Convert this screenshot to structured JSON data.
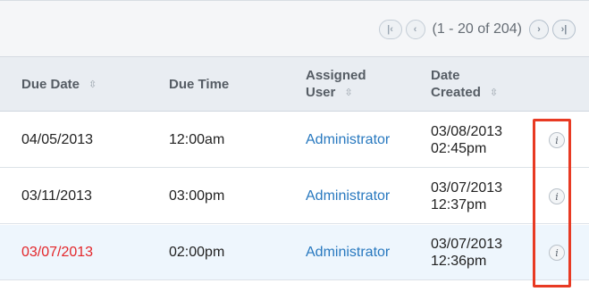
{
  "pager": {
    "first_icon": "first-page-icon",
    "prev_icon": "previous-page-icon",
    "next_icon": "next-page-icon",
    "last_icon": "last-page-icon",
    "first_glyph": "|‹",
    "prev_glyph": "‹",
    "next_glyph": "›",
    "last_glyph": "›|",
    "range_text": "(1 - 20 of 204)"
  },
  "columns": {
    "due_date": "Due Date",
    "due_time": "Due Time",
    "assigned_user_line1": "Assigned",
    "assigned_user_line2": "User",
    "date_created_line1": "Date",
    "date_created_line2": "Created",
    "sort_glyph": "⇳"
  },
  "rows": [
    {
      "due_date": "04/05/2013",
      "due_time": "12:00am",
      "assigned_user": "Administrator",
      "created_date": "03/08/2013",
      "created_time": "02:45pm",
      "overdue": false,
      "info_glyph": "i"
    },
    {
      "due_date": "03/11/2013",
      "due_time": "03:00pm",
      "assigned_user": "Administrator",
      "created_date": "03/07/2013",
      "created_time": "12:37pm",
      "overdue": false,
      "info_glyph": "i"
    },
    {
      "due_date": "03/07/2013",
      "due_time": "02:00pm",
      "assigned_user": "Administrator",
      "created_date": "03/07/2013",
      "created_time": "12:36pm",
      "overdue": true,
      "info_glyph": "i"
    }
  ],
  "colors": {
    "link": "#2778bf",
    "overdue": "#e3262a",
    "callout": "#e83a23",
    "header_bg": "#e9edf2",
    "highlight_row_bg": "#eef6fd"
  }
}
